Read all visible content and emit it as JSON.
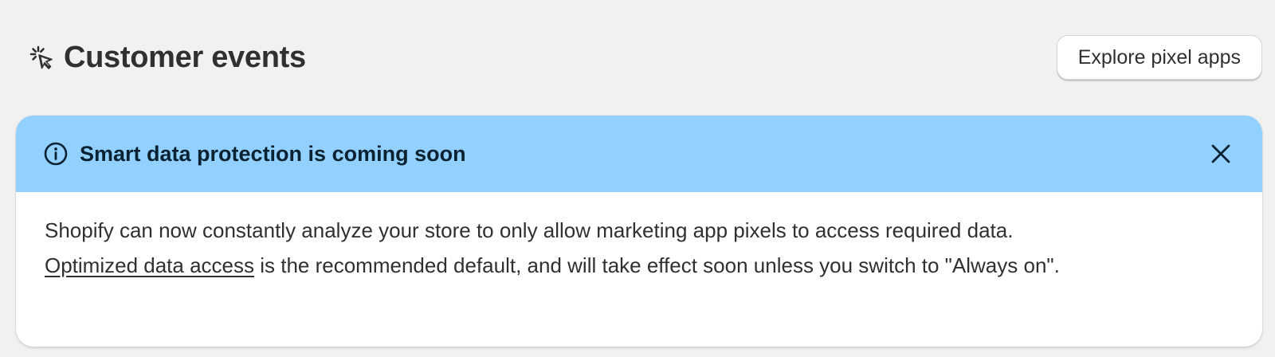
{
  "header": {
    "title": "Customer events",
    "title_icon": "cursor-click-icon",
    "explore_button_label": "Explore pixel apps"
  },
  "banner": {
    "status": "info",
    "accent_color": "#91d0ff",
    "icon": "info-icon",
    "title": "Smart data protection is coming soon",
    "dismiss_icon": "close-icon",
    "body_line1": "Shopify can now constantly analyze your store to only allow marketing app pixels to access required data.",
    "link_text": "Optimized data access",
    "body_line2": " is the recommended default, and will take effect soon unless you switch to \"Always on\"."
  }
}
